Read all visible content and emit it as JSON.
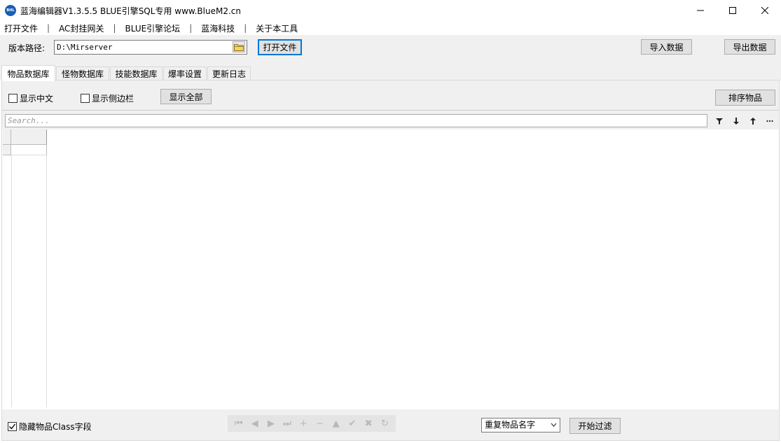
{
  "window": {
    "title": "蓝海编辑器V1.3.5.5  BLUE引擎SQL专用   www.BlueM2.cn",
    "logo_text": "BHL"
  },
  "menu": {
    "items": [
      "打开文件",
      "AC封挂网关",
      "BLUE引擎论坛",
      "蓝海科技",
      "关于本工具"
    ],
    "separator": "|"
  },
  "pathbar": {
    "label": "版本路径:",
    "path_value": "D:\\Mirserver",
    "open_button": "打开文件",
    "import_button": "导入数据",
    "export_button": "导出数据"
  },
  "tabs": [
    {
      "label": "物品数据库",
      "active": true
    },
    {
      "label": "怪物数据库",
      "active": false
    },
    {
      "label": "技能数据库",
      "active": false
    },
    {
      "label": "爆率设置",
      "active": false
    },
    {
      "label": "更新日志",
      "active": false
    }
  ],
  "toolbar": {
    "show_chinese": {
      "label": "显示中文",
      "checked": false
    },
    "show_sidebar": {
      "label": "显示侧边栏",
      "checked": false
    },
    "show_all_button": "显示全部",
    "sort_button": "排序物品"
  },
  "search": {
    "placeholder": "Search..."
  },
  "bottom": {
    "hide_class": {
      "label": "隐藏物品Class字段",
      "checked": true
    },
    "filter_select_value": "重复物品名字",
    "filter_button": "开始过滤"
  },
  "colors": {
    "background": "#f0f0f0",
    "focus_border": "#0078d7",
    "logo": "#1a5fb4"
  }
}
